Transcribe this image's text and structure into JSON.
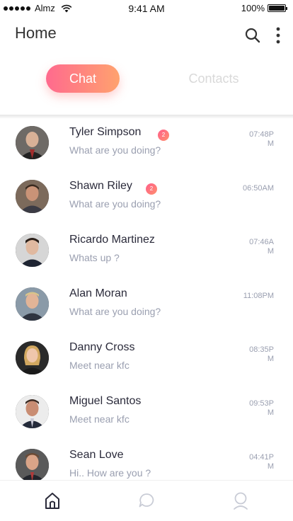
{
  "status_bar": {
    "carrier": "Almz",
    "time": "9:41 AM",
    "battery": "100%"
  },
  "header": {
    "title": "Home"
  },
  "tabs": [
    {
      "label": "Chat",
      "active": true
    },
    {
      "label": "Contacts",
      "active": false
    }
  ],
  "chats": [
    {
      "name": "Tyler Simpson",
      "message": "What are you doing?",
      "time": "07:48PM",
      "unread": "2"
    },
    {
      "name": "Shawn Riley",
      "message": "What are you doing?",
      "time": "06:50AM",
      "unread": "2"
    },
    {
      "name": "Ricardo Martinez",
      "message": "Whats up ?",
      "time": "07:46AM",
      "unread": null
    },
    {
      "name": "Alan Moran",
      "message": "What are you doing?",
      "time": "11:08PM",
      "unread": null
    },
    {
      "name": "Danny Cross",
      "message": "Meet near kfc",
      "time": "08:35PM",
      "unread": null
    },
    {
      "name": "Miguel Santos",
      "message": "Meet near kfc",
      "time": "09:53PM",
      "unread": null
    },
    {
      "name": "Sean Love",
      "message": "Hi.. How are you ?",
      "time": "04:41PM",
      "unread": null
    }
  ],
  "bottom_nav": [
    {
      "icon": "home-icon",
      "active": true
    },
    {
      "icon": "chat-bubble-icon",
      "active": false
    },
    {
      "icon": "profile-icon",
      "active": false
    }
  ],
  "colors": {
    "accent_start": "#ff6a8e",
    "accent_end": "#ffa26e",
    "text_primary": "#2a2a3a",
    "text_secondary": "#9a9fb0"
  }
}
